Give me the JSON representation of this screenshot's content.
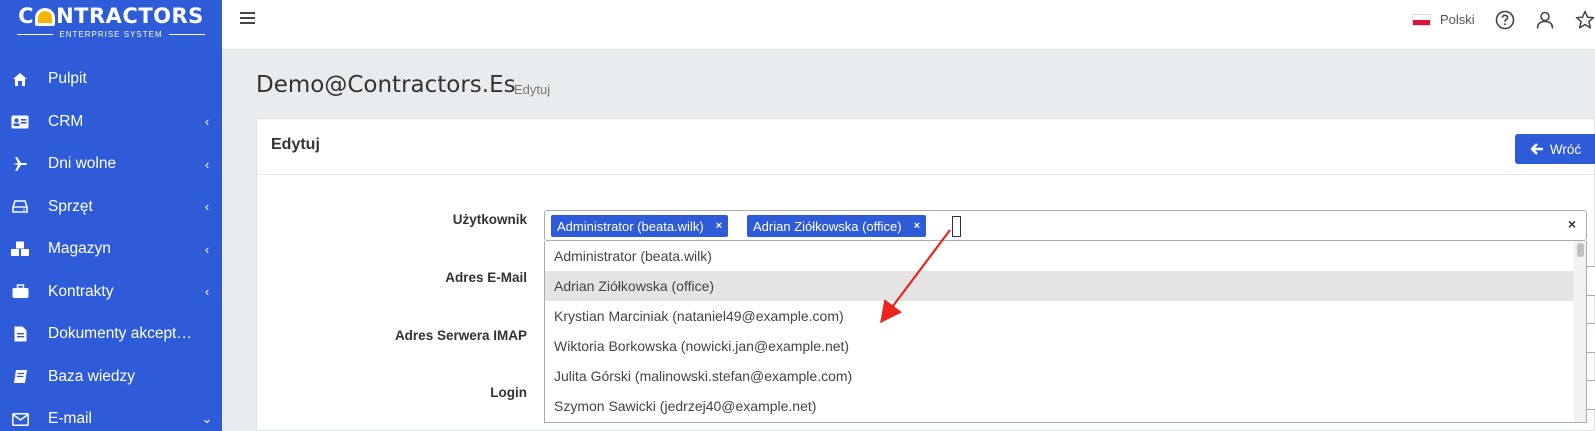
{
  "brand": {
    "name_pre": "C",
    "name_post": "NTRACTORS",
    "tagline": "ENTERPRISE SYSTEM"
  },
  "sidebar": {
    "items": [
      {
        "label": "Pulpit",
        "icon": "home-icon",
        "chevron": ""
      },
      {
        "label": "CRM",
        "icon": "id-card-icon",
        "chevron": "‹"
      },
      {
        "label": "Dni wolne",
        "icon": "plane-icon",
        "chevron": "‹"
      },
      {
        "label": "Sprzęt",
        "icon": "hdd-icon",
        "chevron": "‹"
      },
      {
        "label": "Magazyn",
        "icon": "cubes-icon",
        "chevron": "‹"
      },
      {
        "label": "Kontrakty",
        "icon": "briefcase-icon",
        "chevron": "‹"
      },
      {
        "label": "Dokumenty akcept…",
        "icon": "document-icon",
        "chevron": ""
      },
      {
        "label": "Baza wiedzy",
        "icon": "book-icon",
        "chevron": ""
      },
      {
        "label": "E-mail",
        "icon": "envelope-icon",
        "chevron": "⌄"
      }
    ]
  },
  "topbar": {
    "language": "Polski"
  },
  "page": {
    "title": "Demo@Contractors.Es",
    "subtitle": "Edytuj"
  },
  "card": {
    "title": "Edytuj",
    "back_button": "Wróć"
  },
  "form": {
    "user_label": "Użytkownik",
    "email_label": "Adres E-Mail",
    "imap_label": "Adres Serwera IMAP",
    "login_label": "Login",
    "selected_tags": [
      "Administrator (beata.wilk)",
      "Adrian Ziółkowska (office)"
    ],
    "options": [
      "Administrator (beata.wilk)",
      "Adrian Ziółkowska (office)",
      "Krystian Marciniak (nataniel49@example.com)",
      "Wiktoria Borkowska (nowicki.jan@example.net)",
      "Julita Górski (malinowski.stefan@example.com)",
      "Szymon Sawicki (jedrzej40@example.net)"
    ],
    "tag_remove": "×",
    "clear_all": "×"
  },
  "colors": {
    "accent": "#2e5bd7",
    "arrow": "#e8261c"
  }
}
